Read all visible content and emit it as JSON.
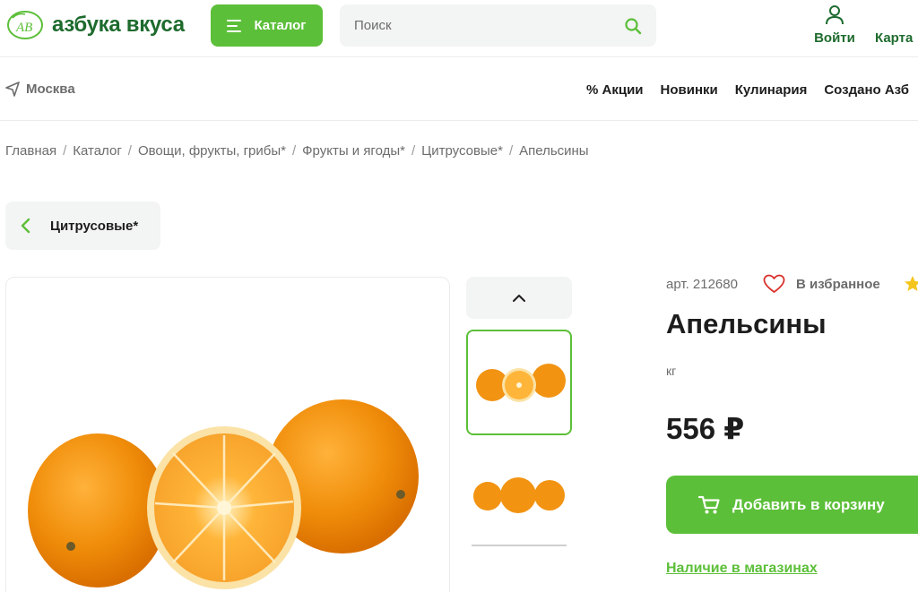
{
  "header": {
    "logo_text": "азбука вкуса",
    "logo_mark": "АВ",
    "catalog_label": "Каталог",
    "search_placeholder": "Поиск",
    "login_label": "Войти",
    "cart_label": "Карта",
    "accent_color": "#5cbf39",
    "brand_color": "#1e6b2e"
  },
  "subnav": {
    "city": "Москва",
    "links": [
      "% Акции",
      "Новинки",
      "Кулинария",
      "Создано Азб"
    ]
  },
  "breadcrumb": [
    "Главная",
    "Каталог",
    "Овощи, фрукты, грибы*",
    "Фрукты и ягоды*",
    "Цитрусовые*",
    "Апельсины"
  ],
  "back_chip": {
    "label": "Цитрусовые*"
  },
  "product": {
    "article": "арт. 212680",
    "favorite_label": "В избранное",
    "title": "Апельсины",
    "unit": "кг",
    "price": "556 ₽",
    "add_to_cart_label": "Добавить в корзину",
    "availability_label": "Наличие в магазинах"
  },
  "icons": [
    "logo-icon",
    "menu-icon",
    "search-icon",
    "user-icon",
    "location-arrow-icon",
    "chevron-left-icon",
    "chevron-up-icon",
    "heart-icon",
    "star-icon",
    "cart-icon"
  ]
}
